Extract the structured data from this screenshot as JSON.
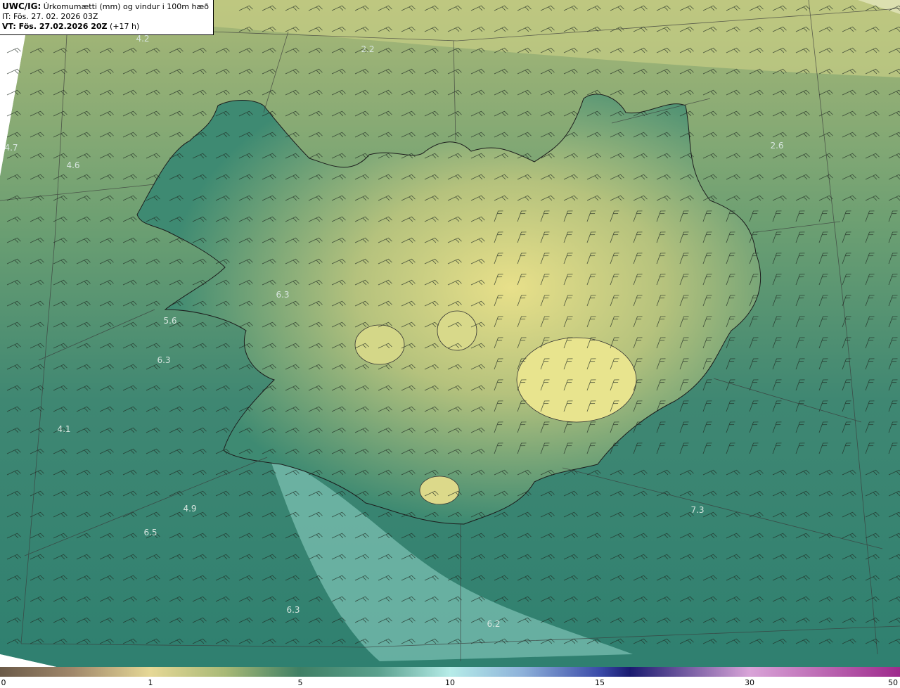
{
  "header": {
    "model_tag": "UWC/IG:",
    "title": "Úrkomumætti (mm) og vindur i 100m hæð",
    "issue_time": "IT: Fös. 27. 02. 2026 03Z",
    "valid_label": "VT: Fös. 27.02.2026 20Z",
    "valid_offset": "(+17 h)"
  },
  "labels": [
    {
      "text": "4.2"
    },
    {
      "text": "2.2"
    },
    {
      "text": "4.7"
    },
    {
      "text": "4.6"
    },
    {
      "text": "2.6"
    },
    {
      "text": "6.3"
    },
    {
      "text": "5.6"
    },
    {
      "text": "6.3"
    },
    {
      "text": "4.1"
    },
    {
      "text": "4.9"
    },
    {
      "text": "6.5"
    },
    {
      "text": "7.3"
    },
    {
      "text": "6.3"
    },
    {
      "text": "6.2"
    }
  ],
  "colorbar": {
    "ticks": [
      "0",
      "1",
      "5",
      "10",
      "15",
      "30",
      "50"
    ],
    "colors": [
      "#6b5a48",
      "#e6d896",
      "#3f7f64",
      "#b6ece8",
      "#1a1a70",
      "#d9a4d8",
      "#9e2a8c"
    ]
  },
  "icons": [
    "wind-barb-icon"
  ]
}
